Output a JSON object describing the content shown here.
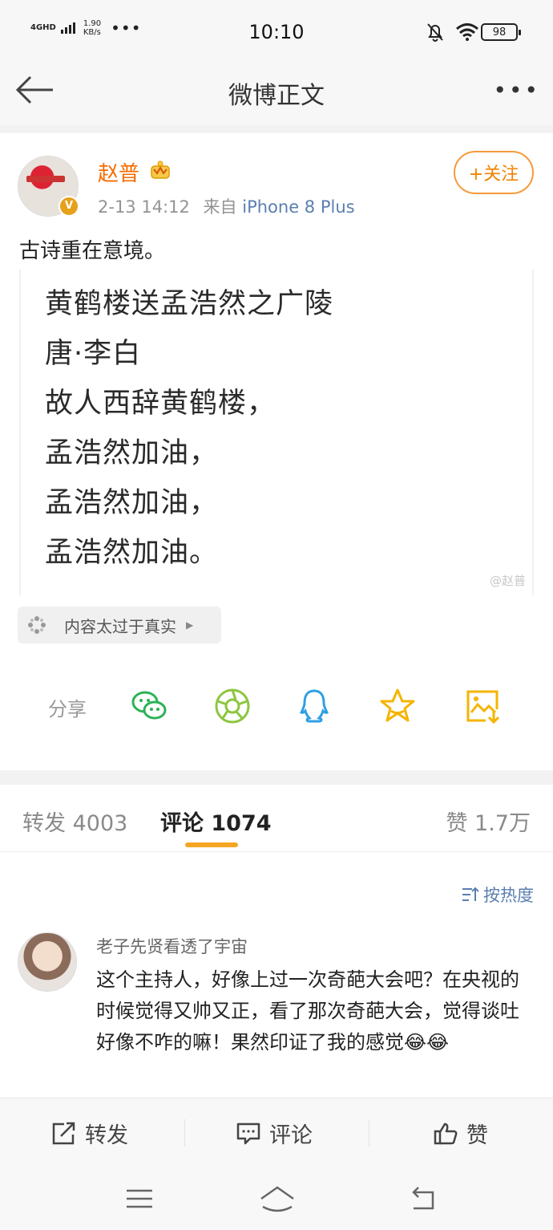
{
  "status": {
    "network": "4GHD",
    "speed_value": "1.90",
    "speed_unit": "KB/s",
    "more_dots": "•••",
    "time": "10:10",
    "battery": "98"
  },
  "nav": {
    "title": "微博正文",
    "more": "•••"
  },
  "post": {
    "username": "赵普",
    "time": "2-13 14:12",
    "from_prefix": "来自",
    "source": "iPhone 8 Plus",
    "follow_label": "+关注",
    "text": "古诗重在意境。",
    "image_lines": [
      "黄鹤楼送孟浩然之广陵",
      "唐·李白",
      "故人西辞黄鹤楼，",
      "孟浩然加油，",
      "孟浩然加油，",
      "孟浩然加油。"
    ],
    "watermark": "@赵普",
    "tag_label": "内容太过于真实",
    "tag_arrow": "▶",
    "share_label": "分享"
  },
  "tabs": {
    "repost": "转发 4003",
    "comment": "评论 1074",
    "like": "赞 1.7万"
  },
  "comments": {
    "sort_label": "按热度",
    "items": [
      {
        "user": "老子先贤看透了宇宙",
        "text": "这个主持人，好像上过一次奇葩大会吧？在央视的时候觉得又帅又正，看了那次奇葩大会，觉得谈吐好像不咋的嘛！果然印证了我的感觉😂😂"
      }
    ]
  },
  "actions": {
    "repost": "转发",
    "comment": "评论",
    "like": "赞"
  },
  "colors": {
    "orange": "#f08200",
    "link_blue": "#5a7fb0",
    "wechat_green": "#2bb255",
    "moments_green": "#8cc63f",
    "qq_blue": "#2e9fe3",
    "star_yellow": "#f5b400",
    "tab_underline": "#f5a623"
  },
  "icons": {
    "back": "arrow-left-icon",
    "share": [
      "wechat-icon",
      "moments-icon",
      "qq-icon",
      "favorite-star-icon",
      "save-image-icon"
    ]
  }
}
